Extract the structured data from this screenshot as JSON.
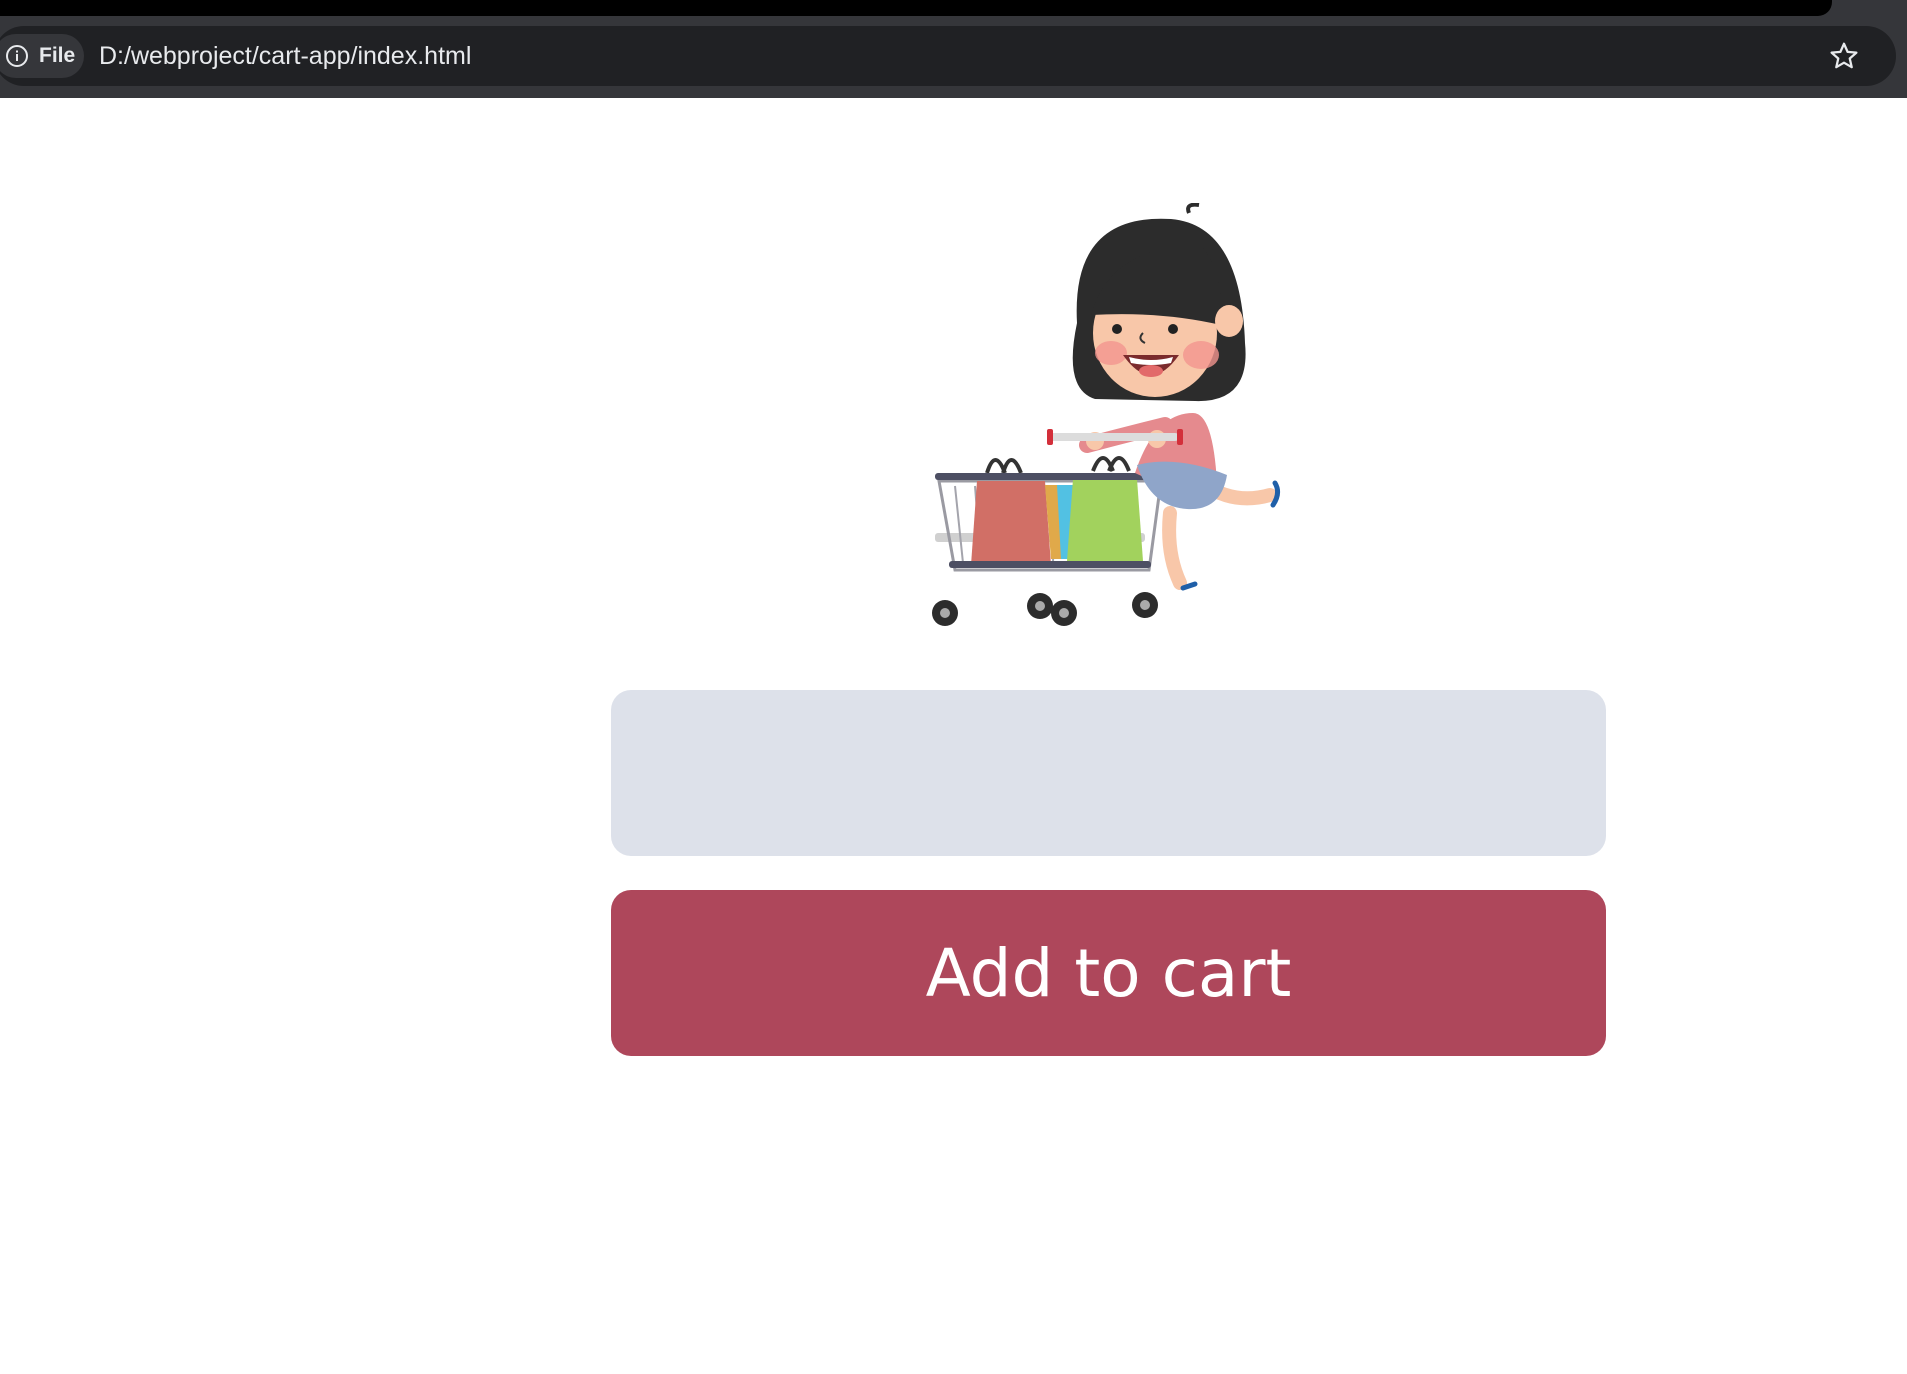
{
  "browser": {
    "site_chip_label": "File",
    "url": "D:/webproject/cart-app/index.html",
    "icons": [
      "info-icon",
      "bookmark-star-icon"
    ]
  },
  "main": {
    "illustration": "girl-pushing-shopping-cart-illustration",
    "input": {
      "value": "",
      "placeholder": ""
    },
    "add_button_label": "Add to cart"
  },
  "colors": {
    "input_background": "#dde1ea",
    "button_background": "#ae475b",
    "button_text": "#ffffff",
    "chrome_background": "#35363a",
    "omnibox_background": "#202124"
  }
}
